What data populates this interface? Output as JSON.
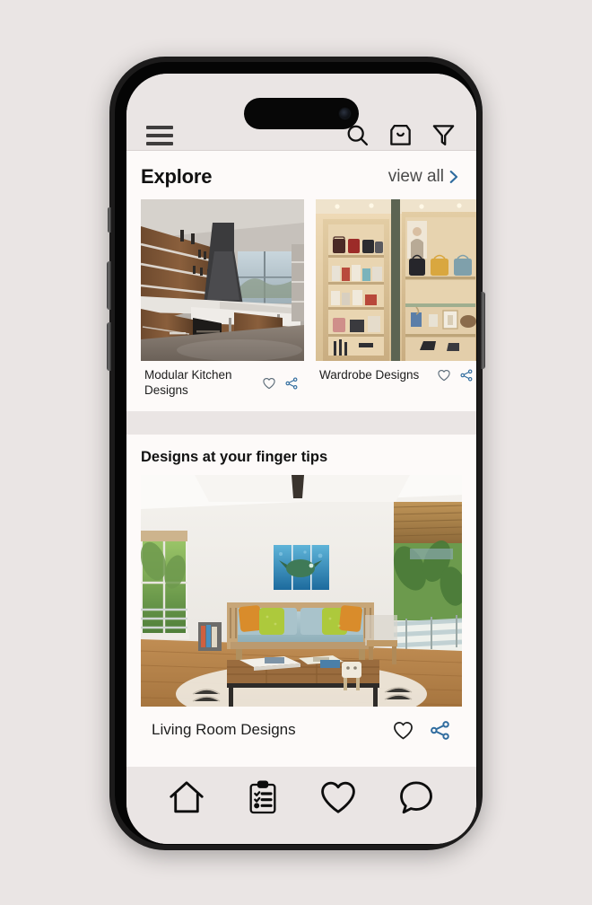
{
  "theme": {
    "page_background": "#eae5e4",
    "panel_background": "#fdfaf9",
    "accent_blue": "#2e6b9e",
    "text_dark": "#111111",
    "text_muted": "#4a4a4a"
  },
  "header": {
    "menu_icon": "hamburger-menu-icon",
    "actions": [
      {
        "name": "search-icon",
        "label": "Search"
      },
      {
        "name": "shopping-bag-icon",
        "label": "Bag"
      },
      {
        "name": "filter-funnel-icon",
        "label": "Filter"
      }
    ]
  },
  "explore": {
    "title": "Explore",
    "view_all_label": "view all",
    "view_all_chevron": "chevron-right-icon",
    "cards": [
      {
        "title": "Modular Kitchen Designs",
        "image": "modular-kitchen-photo",
        "like_icon": "heart-outline-icon",
        "share_icon": "share-nodes-icon"
      },
      {
        "title": "Wardrobe Designs",
        "image": "wardrobe-closet-photo",
        "like_icon": "heart-outline-icon",
        "share_icon": "share-nodes-icon"
      }
    ]
  },
  "finger_tips": {
    "title": "Designs at your finger tips",
    "feature": {
      "title": "Living Room Designs",
      "image": "living-room-photo",
      "like_icon": "heart-outline-icon",
      "share_icon": "share-nodes-icon"
    }
  },
  "bottom_nav": {
    "items": [
      {
        "name": "nav-home",
        "icon": "home-icon",
        "label": "Home"
      },
      {
        "name": "nav-projects",
        "icon": "clipboard-checklist-icon",
        "label": "Projects"
      },
      {
        "name": "nav-favorites",
        "icon": "heart-icon",
        "label": "Favorites"
      },
      {
        "name": "nav-chat",
        "icon": "chat-bubble-icon",
        "label": "Chat"
      }
    ]
  }
}
